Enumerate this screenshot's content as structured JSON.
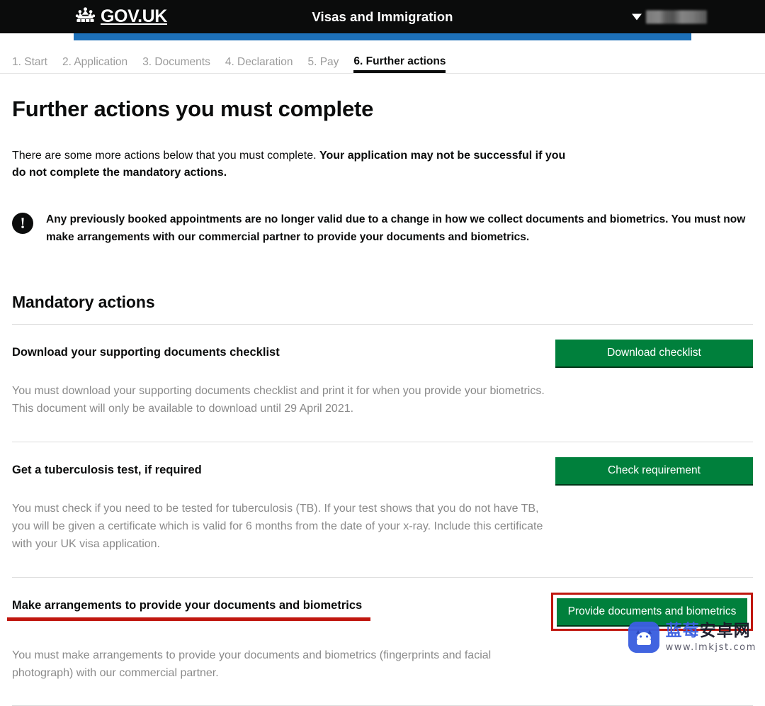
{
  "header": {
    "logo_text": "GOV.UK",
    "crown_icon": "crown-icon",
    "service_name": "Visas and Immigration",
    "account_caret_icon": "chevron-down-icon",
    "account_name_redacted": ""
  },
  "progress": {
    "percent_label": "",
    "fill_color": "#1d70b8"
  },
  "steps": [
    {
      "label": "1. Start",
      "current": false
    },
    {
      "label": "2. Application",
      "current": false
    },
    {
      "label": "3. Documents",
      "current": false
    },
    {
      "label": "4. Declaration",
      "current": false
    },
    {
      "label": "5. Pay",
      "current": false
    },
    {
      "label": "6. Further actions",
      "current": true
    }
  ],
  "main": {
    "page_title": "Further actions you must complete",
    "intro_lead": "There are some more actions below that you must complete. ",
    "intro_bold": "Your application may not be successful if you do not complete the mandatory actions.",
    "alert_icon": "exclamation-circle-icon",
    "alert_text": "Any previously booked appointments are no longer valid due to a change in how we collect documents and biometrics. You must now make arrangements with our commercial partner to provide your documents and biometrics.",
    "section_title": "Mandatory actions"
  },
  "actions": [
    {
      "heading": "Download your supporting documents checklist",
      "button_label": "Download checklist",
      "body": "You must download your supporting documents checklist and print it for when you provide your biometrics. This document will only be available to download until 29 April 2021.",
      "annotated": false
    },
    {
      "heading": "Get a tuberculosis test, if required",
      "button_label": "Check requirement",
      "body": "You must check if you need to be tested for tuberculosis (TB). If your test shows that you do not have TB, you will be given a certificate which is valid for 6 months from the date of your x-ray. Include this certificate with your UK visa application.",
      "annotated": false
    },
    {
      "heading": "Make arrangements to provide your documents and biometrics",
      "button_label": "Provide documents and biometrics",
      "body": "You must make arrangements to provide your documents and biometrics (fingerprints and facial photograph) with our commercial partner.",
      "annotated": true
    }
  ],
  "colors": {
    "govuk_black": "#0b0c0c",
    "govuk_blue": "#1d70b8",
    "button_green": "#00803c",
    "annotation_red": "#c0170f",
    "muted_text": "#8a8a8a"
  },
  "watermark": {
    "logo_icon": "android-robot-logo-icon",
    "brand_prefix": "蓝莓",
    "brand_suffix": "安卓网",
    "url": "www.lmkjst.com"
  }
}
